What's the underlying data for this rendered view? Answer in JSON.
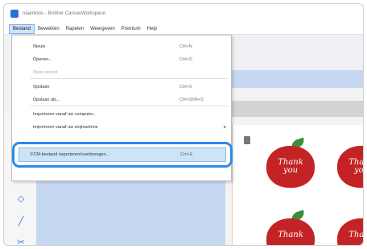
{
  "window": {
    "title": "naamloos - Brother CanvasWorkspace"
  },
  "menubar": {
    "items": [
      "Bestand",
      "Bewerken",
      "Rapelen",
      "Weergeven",
      "Premium",
      "Help"
    ]
  },
  "file_menu": {
    "items": [
      {
        "label": "Nieuw",
        "shortcut": "Ctrl+N"
      },
      {
        "label": "Openen...",
        "shortcut": "Ctrl+O"
      },
      {
        "label": "Open recent",
        "shortcut": ""
      },
      {
        "label": "Opslaan",
        "shortcut": "Ctrl+S"
      },
      {
        "label": "Opslaan als...",
        "shortcut": "Ctrl+Shift+S"
      },
      {
        "label": "Importeren vanaf uw computer...",
        "shortcut": ""
      },
      {
        "label": "Importeren vanaf uw snijmachine",
        "shortcut": ""
      }
    ],
    "highlighted": {
      "label": "FCM-bestand exporteren/overbrengen...",
      "shortcut": "Ctrl+E"
    }
  },
  "canvas": {
    "apple_text": [
      "Thank",
      "you"
    ],
    "colors": {
      "apple": "#c42326",
      "leaf": "#3a8f3a",
      "highlight": "#2a8bea"
    }
  },
  "toolbar": {
    "icons": [
      "shape-icon",
      "line-icon",
      "scissors-icon"
    ]
  }
}
